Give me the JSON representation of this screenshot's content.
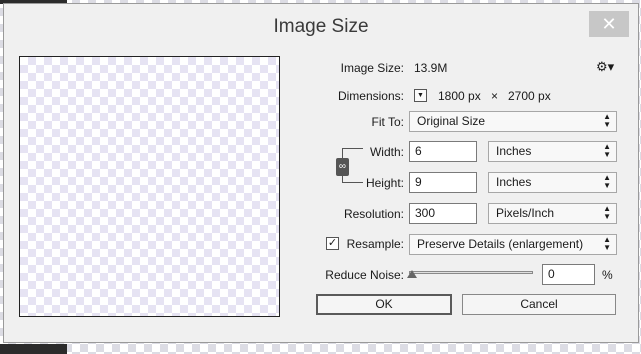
{
  "dialog": {
    "title": "Image Size",
    "close_glyph": "✕"
  },
  "image_size": {
    "label": "Image Size:",
    "value": "13.9M"
  },
  "settings": {
    "icon": "gear-icon",
    "glyph": "⚙▾"
  },
  "dimensions": {
    "label": "Dimensions:",
    "width": "1800 px",
    "times": "×",
    "height": "2700 px"
  },
  "fit_to": {
    "label": "Fit To:",
    "value": "Original Size"
  },
  "width": {
    "label": "Width:",
    "value": "6",
    "unit": "Inches"
  },
  "height": {
    "label": "Height:",
    "value": "9",
    "unit": "Inches"
  },
  "resolution": {
    "label": "Resolution:",
    "value": "300",
    "unit": "Pixels/Inch"
  },
  "resample": {
    "label": "Resample:",
    "checked": true,
    "check_glyph": "✓",
    "value": "Preserve Details (enlargement)"
  },
  "reduce_noise": {
    "label": "Reduce Noise:",
    "value": "0",
    "unit": "%",
    "level_fraction": 0.0
  },
  "buttons": {
    "ok": "OK",
    "cancel": "Cancel"
  },
  "icons": {
    "chain": "chain-link-icon",
    "arrows": "▲▼",
    "dropdown_arrow": "▼"
  }
}
